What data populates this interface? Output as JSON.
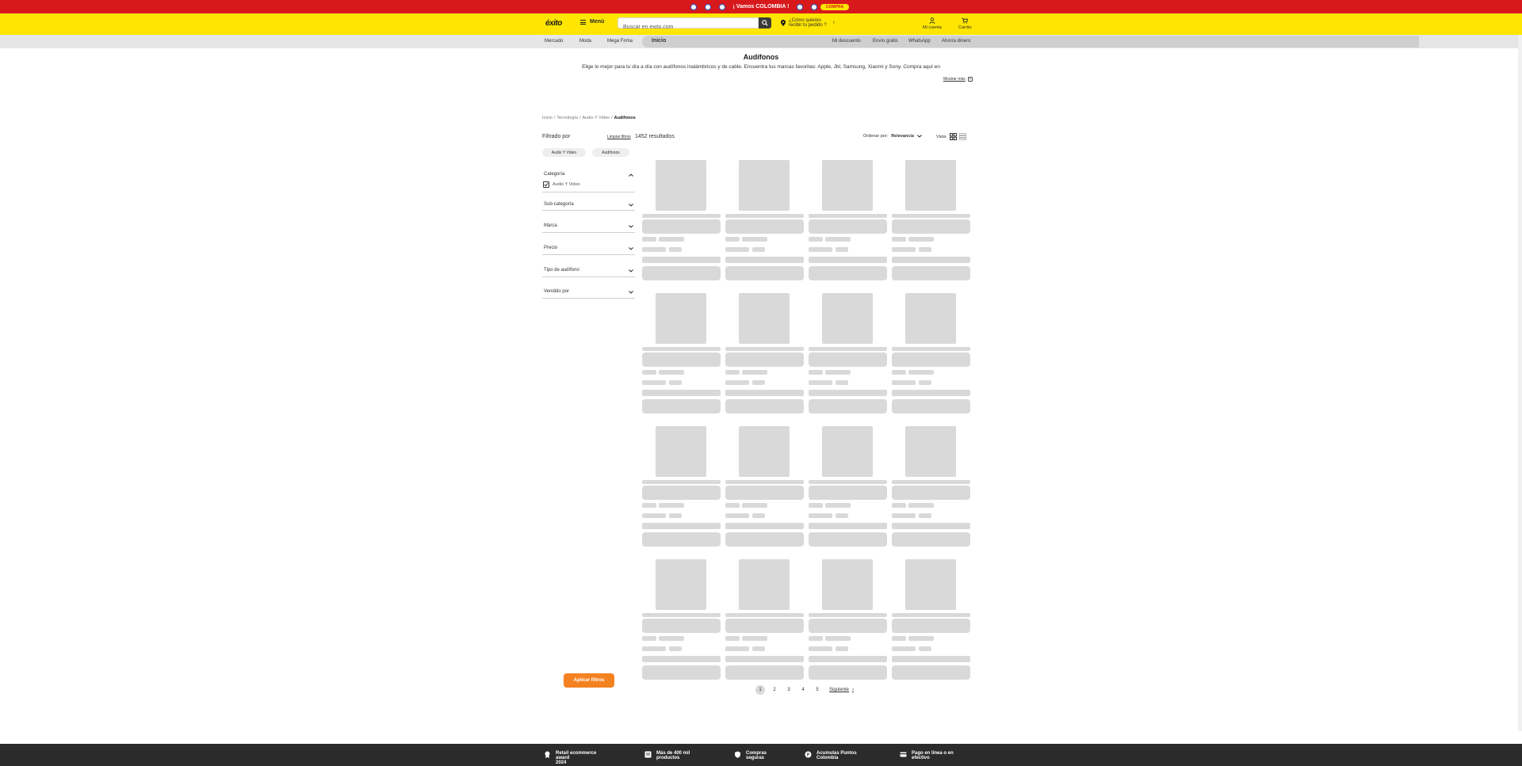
{
  "promo": {
    "text": "¡ Vamos COLOMBIA !",
    "button": "COMPRA"
  },
  "header": {
    "logo": "éxito",
    "menu_label": "Menú",
    "search_placeholder": "Buscar en exito.com",
    "delivery_line1": "¿Cómo quieres",
    "delivery_line2": "recibir tu pedido ?",
    "account_label": "Mi cuenta",
    "cart_label": "Carrito"
  },
  "subnav": {
    "left": [
      "Mercado",
      "Moda",
      "Mega Firma"
    ],
    "current": "Inicio",
    "right": [
      "Mi descuento",
      "Envío gratis",
      "WhatsApp",
      "Ahorra dinero"
    ]
  },
  "category": {
    "title": "Audífonos",
    "description": "Elige lo mejor para tu día a día con audífonos inalámbricos y de cable. Encuentra tus marcas favoritas: Apple, Jbl, Samsung, Xiaomi y Sony. Compra aquí en",
    "show_more": "Mostrar más"
  },
  "breadcrumb": [
    "Inicio",
    "Tecnología",
    "Audio Y Video",
    "Audífonos"
  ],
  "filters": {
    "title": "Filtrado por",
    "clear": "Limpiar filtros",
    "results": "1452 resultados",
    "chips": [
      "Audio Y Video",
      "Audífonos"
    ],
    "category_title": "Categoría",
    "category_option": "Audio Y Video",
    "facets": [
      "Sub-categoría",
      "Marca",
      "Precio",
      "Tipo de audífono",
      "Vendido por"
    ],
    "apply": "Aplicar filtros"
  },
  "sort": {
    "label": "Ordenar por:",
    "value": "Relevancia",
    "view_label": "Vista:"
  },
  "products": {
    "loading": true,
    "rows": 4,
    "columns": 4
  },
  "pagination": {
    "pages": [
      "1",
      "2",
      "3",
      "4",
      "5"
    ],
    "active": "1",
    "next": "Siguiente"
  },
  "footer": {
    "items": [
      {
        "line1": "Retail ecommerce award",
        "line2": "2024",
        "icon": "award-icon"
      },
      {
        "line1": "Más de 400 mil",
        "line2": "productos",
        "icon": "catalog-icon"
      },
      {
        "line1": "Compras",
        "line2": "seguras",
        "icon": "shield-icon"
      },
      {
        "line1": "Acumulas Puntos",
        "line2": "Colombia",
        "icon": "points-icon"
      },
      {
        "line1": "Pago en línea o en",
        "line2": "efectivo",
        "icon": "card-icon"
      }
    ]
  },
  "colors": {
    "promo_red": "#d7191c",
    "brand_yellow": "#ffe600",
    "apply_orange": "#f58220",
    "footer_dark": "#2b2b2b"
  }
}
